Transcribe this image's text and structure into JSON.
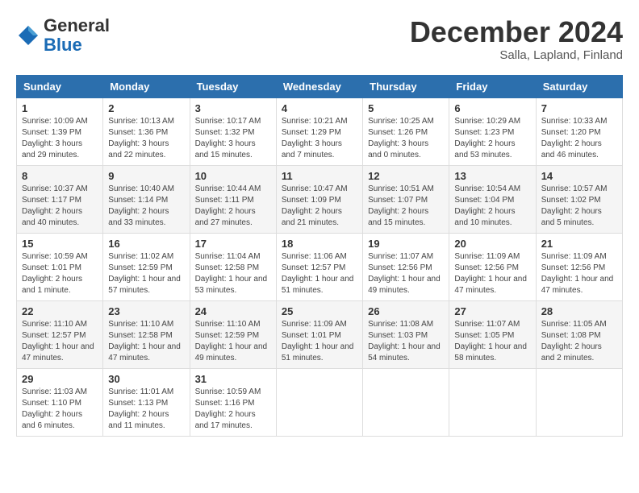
{
  "header": {
    "logo_general": "General",
    "logo_blue": "Blue",
    "month_title": "December 2024",
    "subtitle": "Salla, Lapland, Finland"
  },
  "weekdays": [
    "Sunday",
    "Monday",
    "Tuesday",
    "Wednesday",
    "Thursday",
    "Friday",
    "Saturday"
  ],
  "weeks": [
    [
      {
        "day": "1",
        "info": "Sunrise: 10:09 AM\nSunset: 1:39 PM\nDaylight: 3 hours and 29 minutes."
      },
      {
        "day": "2",
        "info": "Sunrise: 10:13 AM\nSunset: 1:36 PM\nDaylight: 3 hours and 22 minutes."
      },
      {
        "day": "3",
        "info": "Sunrise: 10:17 AM\nSunset: 1:32 PM\nDaylight: 3 hours and 15 minutes."
      },
      {
        "day": "4",
        "info": "Sunrise: 10:21 AM\nSunset: 1:29 PM\nDaylight: 3 hours and 7 minutes."
      },
      {
        "day": "5",
        "info": "Sunrise: 10:25 AM\nSunset: 1:26 PM\nDaylight: 3 hours and 0 minutes."
      },
      {
        "day": "6",
        "info": "Sunrise: 10:29 AM\nSunset: 1:23 PM\nDaylight: 2 hours and 53 minutes."
      },
      {
        "day": "7",
        "info": "Sunrise: 10:33 AM\nSunset: 1:20 PM\nDaylight: 2 hours and 46 minutes."
      }
    ],
    [
      {
        "day": "8",
        "info": "Sunrise: 10:37 AM\nSunset: 1:17 PM\nDaylight: 2 hours and 40 minutes."
      },
      {
        "day": "9",
        "info": "Sunrise: 10:40 AM\nSunset: 1:14 PM\nDaylight: 2 hours and 33 minutes."
      },
      {
        "day": "10",
        "info": "Sunrise: 10:44 AM\nSunset: 1:11 PM\nDaylight: 2 hours and 27 minutes."
      },
      {
        "day": "11",
        "info": "Sunrise: 10:47 AM\nSunset: 1:09 PM\nDaylight: 2 hours and 21 minutes."
      },
      {
        "day": "12",
        "info": "Sunrise: 10:51 AM\nSunset: 1:07 PM\nDaylight: 2 hours and 15 minutes."
      },
      {
        "day": "13",
        "info": "Sunrise: 10:54 AM\nSunset: 1:04 PM\nDaylight: 2 hours and 10 minutes."
      },
      {
        "day": "14",
        "info": "Sunrise: 10:57 AM\nSunset: 1:02 PM\nDaylight: 2 hours and 5 minutes."
      }
    ],
    [
      {
        "day": "15",
        "info": "Sunrise: 10:59 AM\nSunset: 1:01 PM\nDaylight: 2 hours and 1 minute."
      },
      {
        "day": "16",
        "info": "Sunrise: 11:02 AM\nSunset: 12:59 PM\nDaylight: 1 hour and 57 minutes."
      },
      {
        "day": "17",
        "info": "Sunrise: 11:04 AM\nSunset: 12:58 PM\nDaylight: 1 hour and 53 minutes."
      },
      {
        "day": "18",
        "info": "Sunrise: 11:06 AM\nSunset: 12:57 PM\nDaylight: 1 hour and 51 minutes."
      },
      {
        "day": "19",
        "info": "Sunrise: 11:07 AM\nSunset: 12:56 PM\nDaylight: 1 hour and 49 minutes."
      },
      {
        "day": "20",
        "info": "Sunrise: 11:09 AM\nSunset: 12:56 PM\nDaylight: 1 hour and 47 minutes."
      },
      {
        "day": "21",
        "info": "Sunrise: 11:09 AM\nSunset: 12:56 PM\nDaylight: 1 hour and 47 minutes."
      }
    ],
    [
      {
        "day": "22",
        "info": "Sunrise: 11:10 AM\nSunset: 12:57 PM\nDaylight: 1 hour and 47 minutes."
      },
      {
        "day": "23",
        "info": "Sunrise: 11:10 AM\nSunset: 12:58 PM\nDaylight: 1 hour and 47 minutes."
      },
      {
        "day": "24",
        "info": "Sunrise: 11:10 AM\nSunset: 12:59 PM\nDaylight: 1 hour and 49 minutes."
      },
      {
        "day": "25",
        "info": "Sunrise: 11:09 AM\nSunset: 1:01 PM\nDaylight: 1 hour and 51 minutes."
      },
      {
        "day": "26",
        "info": "Sunrise: 11:08 AM\nSunset: 1:03 PM\nDaylight: 1 hour and 54 minutes."
      },
      {
        "day": "27",
        "info": "Sunrise: 11:07 AM\nSunset: 1:05 PM\nDaylight: 1 hour and 58 minutes."
      },
      {
        "day": "28",
        "info": "Sunrise: 11:05 AM\nSunset: 1:08 PM\nDaylight: 2 hours and 2 minutes."
      }
    ],
    [
      {
        "day": "29",
        "info": "Sunrise: 11:03 AM\nSunset: 1:10 PM\nDaylight: 2 hours and 6 minutes."
      },
      {
        "day": "30",
        "info": "Sunrise: 11:01 AM\nSunset: 1:13 PM\nDaylight: 2 hours and 11 minutes."
      },
      {
        "day": "31",
        "info": "Sunrise: 10:59 AM\nSunset: 1:16 PM\nDaylight: 2 hours and 17 minutes."
      },
      null,
      null,
      null,
      null
    ]
  ]
}
